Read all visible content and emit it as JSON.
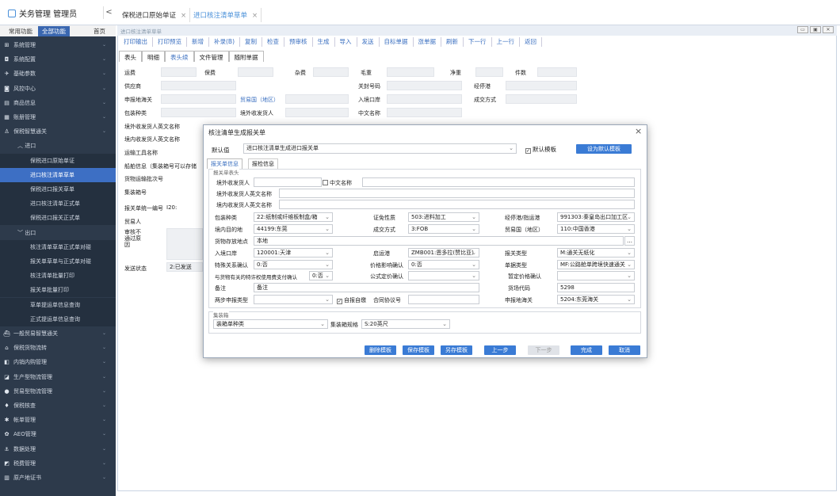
{
  "app": {
    "title": "关务管理 管理员",
    "collapse": "<",
    "tabs": [
      {
        "label": "保税进口原始单证",
        "close": "×"
      },
      {
        "label": "进口核注清单草单",
        "close": "×"
      }
    ]
  },
  "sidebar": {
    "tab_common": "常用功能",
    "tab_all": "全部功能",
    "tab_home": "首页",
    "items": [
      {
        "icon": "⊞",
        "label": "系统管理"
      },
      {
        "icon": "◘",
        "label": "系统配置"
      },
      {
        "icon": "✈",
        "label": "基础参数"
      },
      {
        "icon": "◙",
        "label": "风控中心"
      },
      {
        "icon": "▤",
        "label": "商品信息"
      },
      {
        "icon": "▦",
        "label": "账册管理"
      },
      {
        "icon": "♙",
        "label": "保税智慧通关"
      }
    ],
    "group_import": "进口",
    "import_items": [
      "保税进口原始单证",
      "进口核注清单草单",
      "保税进口报关草单",
      "进口核注清单正式单",
      "保税进口报关正式单"
    ],
    "group_export": "出口",
    "export_items": [
      "核注清单草单正式单对碰",
      "报关单草单与正式单对碰",
      "核注清单批量打印",
      "报关单批量打印",
      "草单提运单信息查询",
      "正式提运单信息查询"
    ],
    "bottom_items": [
      {
        "icon": "⛴",
        "label": "一般贸易智慧通关"
      },
      {
        "icon": "⌂",
        "label": "保税货物流转"
      },
      {
        "icon": "◧",
        "label": "内销内购管理"
      },
      {
        "icon": "◪",
        "label": "生产型物流管理"
      },
      {
        "icon": "●",
        "label": "贸易型物流管理"
      },
      {
        "icon": "♦",
        "label": "保税核查"
      },
      {
        "icon": "✱",
        "label": "帐单管理"
      },
      {
        "icon": "✿",
        "label": "AEO管理"
      },
      {
        "icon": "⚓",
        "label": "数据处理"
      },
      {
        "icon": "◩",
        "label": "税费管理"
      },
      {
        "icon": "▥",
        "label": "原产地证书"
      }
    ]
  },
  "main": {
    "breadcrumb": "进口核注清单草单",
    "window_controls": [
      "▭",
      "▣",
      "✕"
    ],
    "toolbar": [
      "打印输出",
      "打印预览",
      "新增",
      "补录(B)",
      "复制",
      "检查",
      "预审核",
      "生成",
      "导入",
      "发送",
      "自标单据",
      "涨单据",
      "刷新",
      "下一行",
      "上一行",
      "返回"
    ],
    "form_tabs": [
      "表头",
      "明细",
      "表头续",
      "文件管理",
      "随附单据"
    ],
    "fields": {
      "freight": "运费",
      "insurance": "保费",
      "misc": "杂费",
      "gross": "毛重",
      "net": "净重",
      "pieces": "件数",
      "supplier": "供应商",
      "customs_no": "关封号码",
      "port": "经停港",
      "decl_customs": "申报地海关",
      "trade_country": "贸易国（地区）",
      "entry_port": "入境口岸",
      "deal_mode": "成交方式",
      "pack_type": "包装种类",
      "overseas_consignor": "境外收发货人",
      "cn_name": "中文名称",
      "overseas_en": "境外收发货人英文名称",
      "domestic_en": "境内收发货人英文名称",
      "transport_name": "运输工具名称",
      "ship_info": "船舶信息（集装箱号可以存储",
      "transport_batch": "货物运输批次号",
      "container_no": "集装箱号",
      "decl_no": "报关单统一编号",
      "decl_no_value": "I20:",
      "trader": "贸易人",
      "audit_fail": "审核不通过原因",
      "send_status": "发送状态",
      "send_status_value": "2:已发送"
    }
  },
  "modal": {
    "title": "核注清单生成报关单",
    "close": "×",
    "default_label": "默认值",
    "default_value": "进口核注清单生成进口报关单",
    "default_template": "默认模板",
    "set_default": "设为默认模板",
    "tabs": [
      "报关单信息",
      "报检信息"
    ],
    "section_head": "报关单表头",
    "rows": {
      "overseas": "境外收发货人",
      "cn_name": "中文名称",
      "overseas_en": "境外收发货人英文名称",
      "domestic_en": "境内收发货人英文名称",
      "pack_label": "包装种类",
      "pack_value": "22:纸制或纤维板制盒/箱",
      "cert_label": "证免性质",
      "cert_value": "503:进料加工",
      "stop_label": "经停港/指运港",
      "stop_value": "991303:秦皇岛出口加工区",
      "dest_label": "境内目的地",
      "dest_value": "44199:东莞",
      "deal_label": "成交方式",
      "deal_value": "3:FOB",
      "country_label": "贸易国（地区）",
      "country_value": "110:中国香港",
      "storage_label": "货物存放地点",
      "storage_value": "本地",
      "port_label": "入境口岸",
      "port_value": "120001:天津",
      "depart_label": "启运港",
      "depart_value": "ZMB001:恩多拉(赞比亚)",
      "type_label": "报关类型",
      "type_value": "M:通关无纸化",
      "special_label": "特殊关系确认",
      "special_value": "0:否",
      "price_label": "价格影响确认",
      "price_value": "0:否",
      "form_label": "单据类型",
      "form_value": "MF:公路舱单跨境快速通关",
      "royalty_label": "与货物有关的特许权使用费支付确认",
      "royalty_value": "0:否",
      "formula_label": "公式定价确认",
      "provisional_label": "暂定价格确认",
      "remark_label": "备注",
      "remark_value": "备注",
      "goods_code_label": "货场代码",
      "goods_code_value": "5298",
      "twostep_label": "两步申报类型",
      "self_check": "自报自缴",
      "contract_label": "合同协议号",
      "decl_customs_label": "申报地海关",
      "decl_customs_value": "5204:东莞海关"
    },
    "container_section": "集装箱",
    "container_type_label": "装箱单种类",
    "container_spec_label": "集装箱规格",
    "container_spec_value": "S:20英尺",
    "buttons": [
      "删除模板",
      "保存模板",
      "另存模板",
      "上一步",
      "下一步",
      "完成",
      "取消"
    ]
  }
}
